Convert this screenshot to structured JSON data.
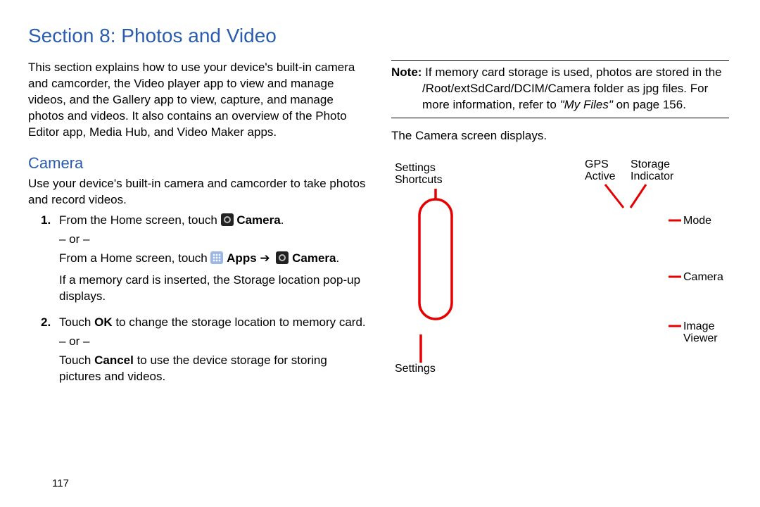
{
  "title": "Section 8: Photos and Video",
  "left": {
    "intro": "This section explains how to use your device's built-in camera and camcorder, the Video player app to view and manage videos, and the Gallery app to view, capture, and manage photos and videos. It also contains an overview of the Photo Editor app, Media Hub, and Video Maker apps.",
    "camera_head": "Camera",
    "camera_intro": "Use your device's built-in camera and camcorder to take photos and record videos.",
    "step1_a_pre": "From the Home screen, touch ",
    "step1_a_bold": " Camera",
    "or": "– or –",
    "step1_b_pre": "From a Home screen, touch ",
    "apps_label": " Apps ",
    "arrow": "➔",
    "camera_label": " Camera",
    "step1_tail": "If a memory card is inserted, the Storage location pop-up displays.",
    "step2_a": "Touch ",
    "ok": "OK",
    "step2_a_tail": " to change the storage location to memory card.",
    "step2_b": "Touch ",
    "cancel": "Cancel",
    "step2_b_tail": " to use the device storage for storing pictures and videos."
  },
  "right": {
    "note_label": "Note: ",
    "note_line1": "If memory card storage is used, photos are stored in the",
    "note_line2": "/Root/extSdCard/DCIM/Camera folder as jpg files. For more information, refer to ",
    "note_ref": "\"My Files\"",
    "note_tail": "  on page 156.",
    "screen_displays": "The Camera screen displays.",
    "labels": {
      "settings_shortcuts": "Settings\nShortcuts",
      "settings": "Settings",
      "gps": "GPS\nActive",
      "storage": "Storage\nIndicator",
      "mode": "Mode",
      "camera": "Camera",
      "image_viewer": "Image\nViewer"
    }
  },
  "page_number": "117"
}
